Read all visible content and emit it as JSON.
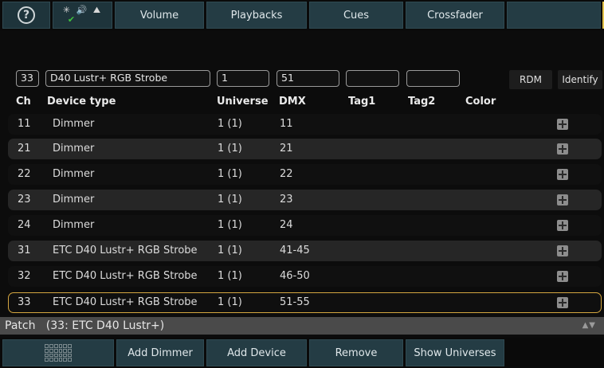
{
  "top_bar": {
    "help_icon": "question-circle-icon",
    "status_icons": "✳ 🔊 ⛰",
    "status_check": "✔",
    "tabs": [
      "Volume",
      "Playbacks",
      "Cues",
      "Crossfader"
    ]
  },
  "edit_row": {
    "channel": "33",
    "device_type": "D40 Lustr+ RGB Strobe",
    "universe": "1",
    "dmx": "51",
    "tag1": "",
    "tag2": "",
    "color": "",
    "rdm_label": "RDM",
    "identify_label": "Identify"
  },
  "columns": {
    "ch": "Ch",
    "device_type": "Device type",
    "universe": "Universe",
    "dmx": "DMX",
    "tag1": "Tag1",
    "tag2": "Tag2",
    "color": "Color"
  },
  "rows": [
    {
      "ch": "11",
      "device": "Dimmer",
      "universe": "1 (1)",
      "dmx": "11"
    },
    {
      "ch": "21",
      "device": "Dimmer",
      "universe": "1 (1)",
      "dmx": "21"
    },
    {
      "ch": "22",
      "device": "Dimmer",
      "universe": "1 (1)",
      "dmx": "22"
    },
    {
      "ch": "23",
      "device": "Dimmer",
      "universe": "1 (1)",
      "dmx": "23"
    },
    {
      "ch": "24",
      "device": "Dimmer",
      "universe": "1 (1)",
      "dmx": "24"
    },
    {
      "ch": "31",
      "device": "ETC D40 Lustr+ RGB Strobe",
      "universe": "1 (1)",
      "dmx": "41-45"
    },
    {
      "ch": "32",
      "device": "ETC D40 Lustr+ RGB Strobe",
      "universe": "1 (1)",
      "dmx": "46-50"
    },
    {
      "ch": "33",
      "device": "ETC D40 Lustr+ RGB Strobe",
      "universe": "1 (1)",
      "dmx": "51-55"
    }
  ],
  "selected_row_index": 7,
  "status": {
    "text": "Patch   (33: ETC D40 Lustr+)",
    "scroll_arrows": "▲▼"
  },
  "bottom_bar": {
    "grid_icon": "grid-icon",
    "buttons": [
      "Add Dimmer",
      "Add Device",
      "Remove",
      "Show Universes"
    ]
  },
  "colors": {
    "button_bg": "#243c44",
    "selection_border": "#d4a640",
    "row_alt": "#262626"
  }
}
